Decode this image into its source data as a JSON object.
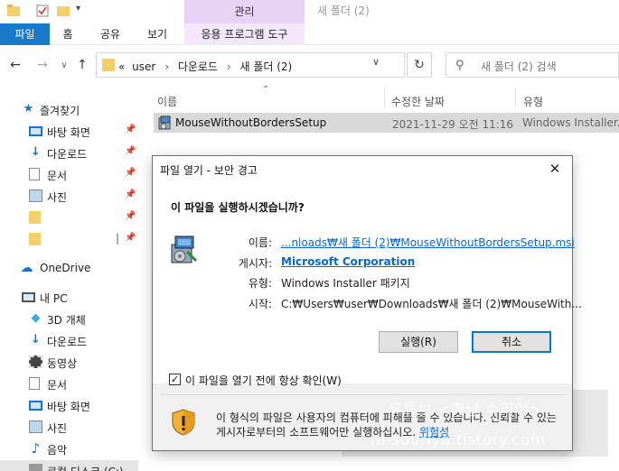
{
  "window": {
    "title": "새 폴더 (2)",
    "context_tab": "관리"
  },
  "ribbon": {
    "tabs": [
      "파일",
      "홈",
      "공유",
      "보기",
      "응용 프로그램 도구"
    ]
  },
  "address": {
    "chevron": "«",
    "path": [
      "user",
      "다운로드",
      "새 폴더 (2)"
    ],
    "search_placeholder": "새 폴더 (2) 검색"
  },
  "sidebar": {
    "items": [
      {
        "label": "즐겨찾기",
        "icon": "star-icon",
        "pinned": false
      },
      {
        "label": "바탕 화면",
        "icon": "desktop-icon",
        "pinned": true
      },
      {
        "label": "다운로드",
        "icon": "download-icon",
        "pinned": true
      },
      {
        "label": "문서",
        "icon": "document-icon",
        "pinned": true
      },
      {
        "label": "사진",
        "icon": "pictures-icon",
        "pinned": true
      },
      {
        "label": "",
        "icon": "folder-icon",
        "pinned": true
      },
      {
        "label": "",
        "icon": "folder-icon",
        "pinned": true
      },
      {
        "label": "OneDrive",
        "icon": "cloud-icon",
        "pinned": false
      },
      {
        "label": "내 PC",
        "icon": "pc-icon",
        "pinned": false
      },
      {
        "label": "3D 개체",
        "icon": "cube-icon",
        "pinned": false
      },
      {
        "label": "다운로드",
        "icon": "download-icon",
        "pinned": false
      },
      {
        "label": "동영상",
        "icon": "video-icon",
        "pinned": false
      },
      {
        "label": "문서",
        "icon": "document-icon",
        "pinned": false
      },
      {
        "label": "바탕 화면",
        "icon": "desktop-icon",
        "pinned": false
      },
      {
        "label": "사진",
        "icon": "pictures-icon",
        "pinned": false
      },
      {
        "label": "음악",
        "icon": "music-icon",
        "pinned": false
      },
      {
        "label": "로컬 디스크 (C:)",
        "icon": "drive-icon",
        "pinned": false
      }
    ]
  },
  "file_list": {
    "columns": [
      "이름",
      "수정한 날짜",
      "유형"
    ],
    "rows": [
      {
        "name": "MouseWithoutBordersSetup",
        "modified": "2021-11-29 오전 11:16",
        "type": "Windows Installer..."
      }
    ]
  },
  "dialog": {
    "title": "파일 열기 - 보안 경고",
    "question": "이 파일을 실행하시겠습니까?",
    "fields": [
      {
        "label": "이름:",
        "value": "...nloads₩새 폴더 (2)₩MouseWithoutBordersSetup.msi",
        "style": "link"
      },
      {
        "label": "게시자:",
        "value": "Microsoft Corporation",
        "style": "bold-link"
      },
      {
        "label": "유형:",
        "value": "Windows Installer 패키지",
        "style": "plain"
      },
      {
        "label": "시작:",
        "value": "C:₩Users₩user₩Downloads₩새 폴더 (2)₩MouseWith...",
        "style": "plain"
      }
    ],
    "run_button": "실행(R)",
    "cancel_button": "취소",
    "checkbox_label": "이 파일을 열기 전에 항상 확인(W)",
    "checkbox_checked": true,
    "warning_text": "이 형식의 파일은 사용자의 컴퓨터에 피해를 줄 수 있습니다. 신뢰할 수 있는 게시자로부터의 소프트웨어만 실행하십시오.",
    "warning_link": "위험성"
  },
  "watermark": {
    "line1": "유튜브 <매날 수리야>",
    "line2": "m-sooriya.tistory.com"
  },
  "colors": {
    "accent": "#1979ca",
    "manage_tab": "#e8d3f7",
    "link": "#0b66c9",
    "selected_row": "#d9d9d9"
  }
}
